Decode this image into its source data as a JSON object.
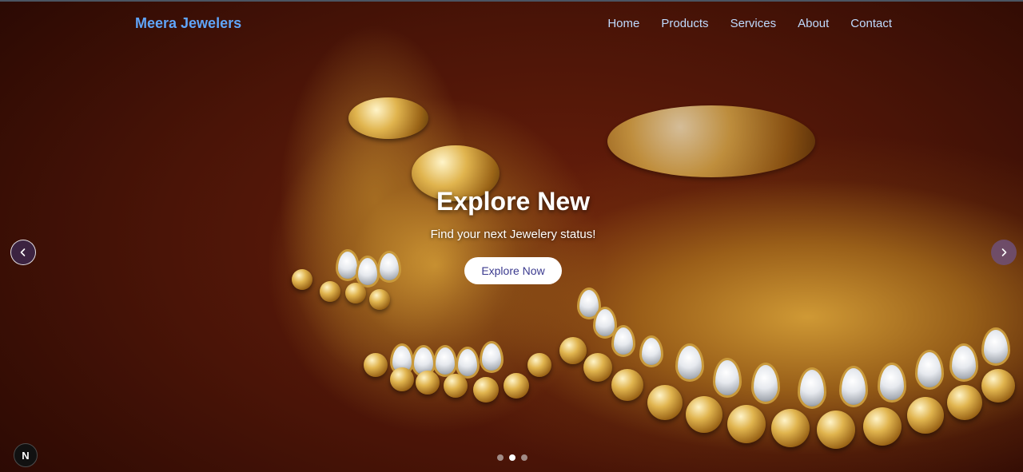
{
  "navbar": {
    "brand": "Meera Jewelers",
    "links": [
      {
        "label": "Home"
      },
      {
        "label": "Products"
      },
      {
        "label": "Services"
      },
      {
        "label": "About"
      },
      {
        "label": "Contact"
      }
    ]
  },
  "hero": {
    "title": "Explore New",
    "subtitle": "Find your next Jewelery status!",
    "button_label": "Explore Now"
  },
  "carousel": {
    "prev_icon": "chevron-left-icon",
    "next_icon": "chevron-right-icon",
    "slide_count": 3,
    "active_index": 1
  },
  "dev_badge": {
    "label": "N",
    "icon": "nextjs-logo-icon"
  },
  "colors": {
    "brand": "#60a5fa",
    "nav_link": "#bfdbfe",
    "button_bg": "#ffffff",
    "button_text": "#3b3a8f"
  }
}
